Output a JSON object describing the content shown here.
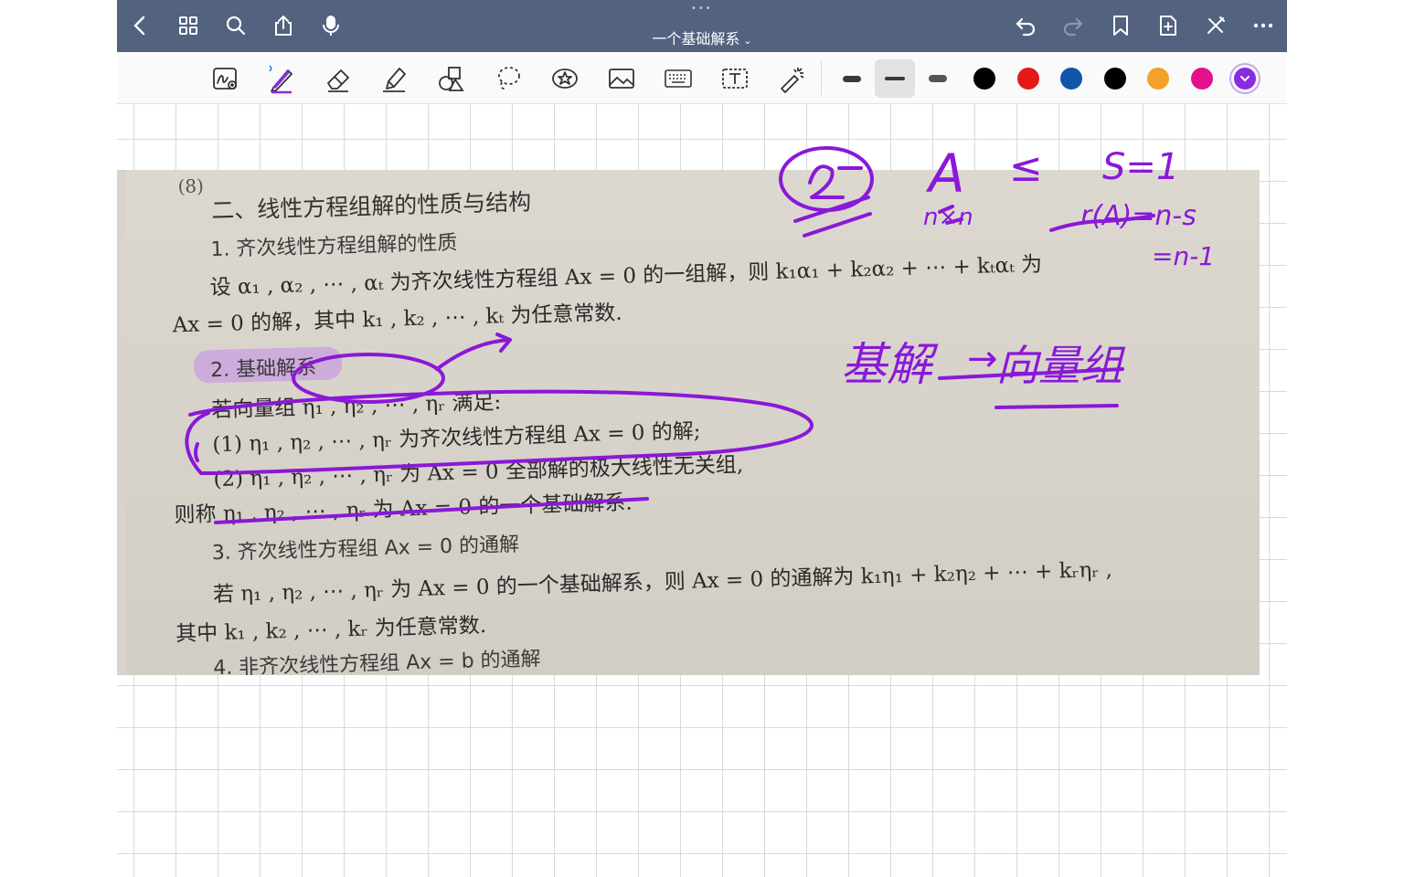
{
  "title": {
    "text": "一个基础解系",
    "chevron": "⌄"
  },
  "titlebar": {
    "left_icons": [
      "back-icon",
      "grid-icon",
      "search-icon",
      "share-icon",
      "microphone-icon"
    ],
    "right_icons": [
      "undo-icon",
      "redo-icon",
      "bookmark-icon",
      "add-page-icon",
      "close-pen-icon",
      "more-icon"
    ]
  },
  "toolbar": {
    "tools": [
      "handwriting-tool",
      "pen-tool",
      "eraser-tool",
      "highlighter-tool",
      "shapes-tool",
      "lasso-tool",
      "sticker-tool",
      "image-tool",
      "keyboard-tool",
      "text-tool",
      "laser-tool"
    ],
    "selected_tool": "pen-tool",
    "thickness_selected": 1,
    "colors": [
      "#000000",
      "#e51818",
      "#0f55a9",
      "#000000",
      "#f2a22a",
      "#e4118c",
      "#8a2be2"
    ],
    "selected_color": "#8a2be2"
  },
  "page": {
    "heading_number": "(8)",
    "section_title": "二、线性方程组解的性质与结构",
    "s1_title": "1. 齐次线性方程组解的性质",
    "s1_line1": "设 α₁ , α₂ , ⋯ , αₜ 为齐次线性方程组 Ax = 0 的一组解，则 k₁α₁ + k₂α₂ + ⋯ + kₜαₜ 为",
    "s1_line2": "Ax = 0 的解，其中 k₁ , k₂ , ⋯ , kₜ 为任意常数.",
    "s2_title": "2. 基础解系",
    "s2_line1": "若向量组 η₁ , η₂ , ⋯ , ηᵣ 满足:",
    "s2_line2": "(1) η₁ , η₂ , ⋯ , ηᵣ 为齐次线性方程组 Ax = 0 的解;",
    "s2_line3": "(2) η₁ , η₂ , ⋯ , ηᵣ 为 Ax = 0 全部解的极大线性无关组,",
    "s2_line4": "则称 η₁ , η₂ , ⋯ , ηᵣ 为 Ax = 0 的一个基础解系.",
    "s3_title": "3. 齐次线性方程组 Ax = 0 的通解",
    "s3_line1": "若 η₁ , η₂ , ⋯ , ηᵣ 为 Ax = 0 的一个基础解系，则 Ax = 0 的通解为 k₁η₁ + k₂η₂ + ⋯ + kᵣηᵣ ,",
    "s3_line2": "其中 k₁ , k₂ , ⋯ , kᵣ 为任意常数.",
    "s4_title": "4. 非齐次线性方程组 Ax = b 的通解"
  },
  "handwriting": {
    "a": "A",
    "nxn": "n×n",
    "s_eq": "S=1",
    "rank": "r(A)=n-s",
    "eq_n1": "=n-1",
    "note_left": "基解",
    "note_right": "向量组"
  }
}
